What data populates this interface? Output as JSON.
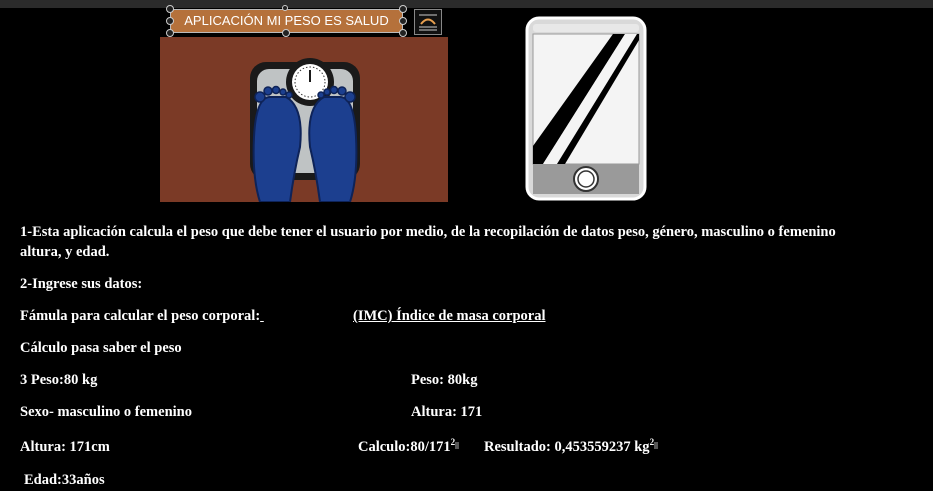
{
  "title_box": {
    "label": "APLICACIÓN MI PESO ES SALUD"
  },
  "body": {
    "line1": "1-Esta aplicación calcula el peso que debe tener el usuario por medio, de la recopilación de datos peso, género, masculino o femenino",
    "line1b": "altura, y edad.",
    "line2": "2-Ingrese sus datos:",
    "formula_label": "Fámula para calcular el peso corporal:",
    "formula_value": "(IMC) Índice de masa corporal",
    "calc_heading": "Cálculo pasa saber el peso",
    "left_peso": "3 Peso:80 kg",
    "right_peso": "Peso: 80kg",
    "left_sexo": "Sexo- masculino o femenino",
    "right_altura": "Altura: 171",
    "left_altura": "Altura: 171cm",
    "calculo": "Calculo:80/171",
    "calculo_exp": "2",
    "resultado": "Resultado: 0,453559237 kg",
    "resultado_exp": "2",
    "edad": "Edad:33años"
  }
}
